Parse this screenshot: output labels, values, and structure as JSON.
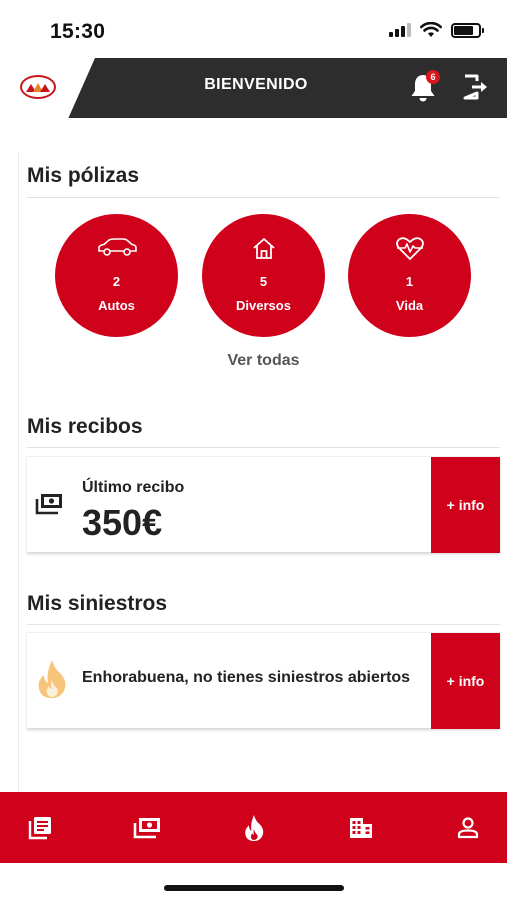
{
  "status_bar": {
    "time": "15:30"
  },
  "header": {
    "title": "BIENVENIDO",
    "notification_count": "6"
  },
  "policies": {
    "title": "Mis pólizas",
    "items": [
      {
        "count": "2",
        "label": "Autos",
        "icon": "car-icon"
      },
      {
        "count": "5",
        "label": "Diversos",
        "icon": "house-icon"
      },
      {
        "count": "1",
        "label": "Vida",
        "icon": "heart-pulse-icon"
      }
    ],
    "view_all": "Ver todas"
  },
  "receipts": {
    "title": "Mis recibos",
    "label": "Último recibo",
    "amount": "350€",
    "info_button": "+ info",
    "icon": "banknote-icon"
  },
  "claims": {
    "title": "Mis siniestros",
    "message": "Enhorabuena, no tienes siniestros abiertos",
    "info_button": "+ info",
    "icon": "fire-icon"
  },
  "bottom_nav": [
    {
      "icon": "policies-icon"
    },
    {
      "icon": "receipts-icon"
    },
    {
      "icon": "claims-icon"
    },
    {
      "icon": "offices-icon"
    },
    {
      "icon": "profile-icon"
    }
  ],
  "colors": {
    "brand_red": "#d0021b",
    "header_dark": "#2d2d2d",
    "fire_light": "#f6c47a"
  }
}
